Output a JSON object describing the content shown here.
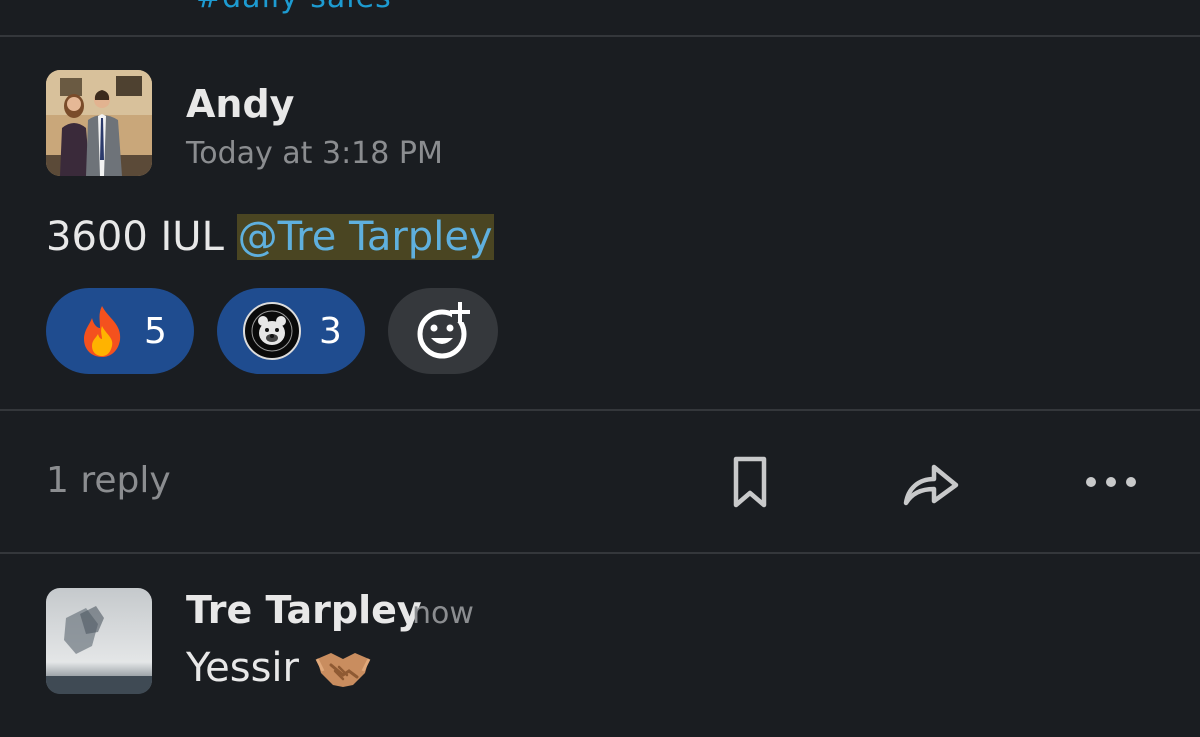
{
  "header": {
    "channel_link": "#daily-sales"
  },
  "message": {
    "author": "Andy",
    "timestamp": "Today at 3:18 PM",
    "text": "3600 IUL",
    "mention": "@Tre Tarpley",
    "reactions": [
      {
        "icon": "fire-emoji",
        "count": "5"
      },
      {
        "icon": "bear-team-emoji",
        "count": "3"
      }
    ],
    "add_reaction_icon": "add-reaction-icon"
  },
  "thread": {
    "reply_count": "1 reply",
    "actions": [
      "bookmark-icon",
      "share-icon",
      "more-icon"
    ]
  },
  "reply": {
    "author": "Tre Tarpley",
    "timestamp": "now",
    "text": "Yessir",
    "emoji": "handshake-emoji"
  },
  "colors": {
    "background": "#1a1d21",
    "mention_bg": "#4a4522",
    "mention_text": "#5fb0de",
    "reaction_bg": "#1f4c8f",
    "divider": "#34373b"
  }
}
